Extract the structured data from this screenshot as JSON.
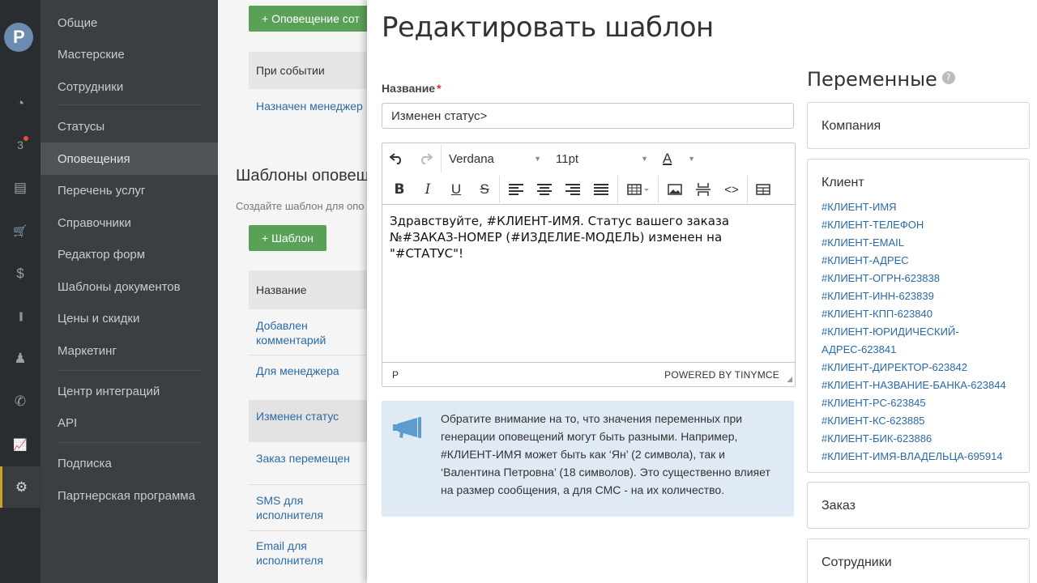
{
  "rail": {
    "items": [
      {
        "icon": "speedometer-icon",
        "glyph": "◔"
      },
      {
        "icon": "calendar-icon",
        "glyph": "3"
      },
      {
        "icon": "inbox-icon",
        "glyph": "▤"
      },
      {
        "icon": "cart-icon",
        "glyph": "🛒"
      },
      {
        "icon": "dollar-icon",
        "glyph": "$"
      },
      {
        "icon": "barcode-icon",
        "glyph": "|||"
      },
      {
        "icon": "person-icon",
        "glyph": "♟"
      },
      {
        "icon": "phone-icon",
        "glyph": "✆"
      },
      {
        "icon": "chart-icon",
        "glyph": "📈"
      },
      {
        "icon": "gear-icon",
        "glyph": "⚙"
      }
    ]
  },
  "menu": {
    "items": [
      "Общие",
      "Мастерские",
      "Сотрудники",
      "Статусы",
      "Оповещения",
      "Перечень услуг",
      "Справочники",
      "Редактор форм",
      "Шаблоны документов",
      "Цены и скидки",
      "Маркетинг",
      "Центр интеграций",
      "API",
      "Подписка",
      "Партнерская программа"
    ],
    "active": "Оповещения"
  },
  "background": {
    "add_notification_button": "+ Оповещение сот",
    "event_header": "При событии",
    "manager_link": "Назначен менеджер",
    "section_title": "Шаблоны оповещ",
    "hint": "Создайте шаблон для опо",
    "add_template_button": "+ Шаблон",
    "name_header": "Название",
    "templates": [
      "Добавлен комментарий",
      "Для менеджера",
      "Изменен статус",
      "Заказ перемещен",
      "SMS для исполнителя",
      "Email для исполнителя"
    ]
  },
  "modal": {
    "title": "Редактировать шаблон",
    "name_label": "Название",
    "required_mark": "*",
    "name_value": "Изменен статус>",
    "editor": {
      "font": "Verdana",
      "size": "11pt",
      "color_glyph": "A",
      "content": "Здравствуйте, #КЛИЕНТ-ИМЯ. Статус вашего заказа №#ЗАКАЗ-НОМЕР (#ИЗДЕЛИЕ-МОДЕЛЬ) изменен на \"#СТАТУС\"!",
      "path": "P",
      "powered_by": "POWERED BY TINYMCE"
    },
    "notice": "Обратите внимание на то, что значения переменных при генерации оповещений могут быть разными. Например, #КЛИЕНТ-ИМЯ может быть как ‘Ян’ (2 символа), так и ‘Валентина Петровна’ (18 символов). Это существенно влияет на размер сообщения, а для СМС - на их количество.",
    "variables": {
      "title": "Переменные",
      "help": "?",
      "groups": {
        "company": "Компания",
        "client": "Клиент",
        "order": "Заказ",
        "staff": "Сотрудники"
      },
      "client_vars": [
        "#КЛИЕНТ-ИМЯ",
        "#КЛИЕНТ-ТЕЛЕФОН",
        "#КЛИЕНТ-EMAIL",
        "#КЛИЕНТ-АДРЕС",
        "#КЛИЕНТ-ОГРН-623838",
        "#КЛИЕНТ-ИНН-623839",
        "#КЛИЕНТ-КПП-623840",
        "#КЛИЕНТ-ЮРИДИЧЕСКИЙ-",
        "АДРЕС-623841",
        "#КЛИЕНТ-ДИРЕКТОР-623842",
        "#КЛИЕНТ-НАЗВАНИЕ-БАНКА-623844",
        "#КЛИЕНТ-РС-623845",
        "#КЛИЕНТ-КС-623885",
        "#КЛИЕНТ-БИК-623886",
        "#КЛИЕНТ-ИМЯ-ВЛАДЕЛЬЦА-695914"
      ]
    }
  },
  "colors": {
    "rail_bg": "#2a2d30",
    "menu_bg": "#3b3e42",
    "accent_green": "#5aa158",
    "link_blue": "#2a6aa6",
    "notice_bg": "#dfeaf5"
  }
}
